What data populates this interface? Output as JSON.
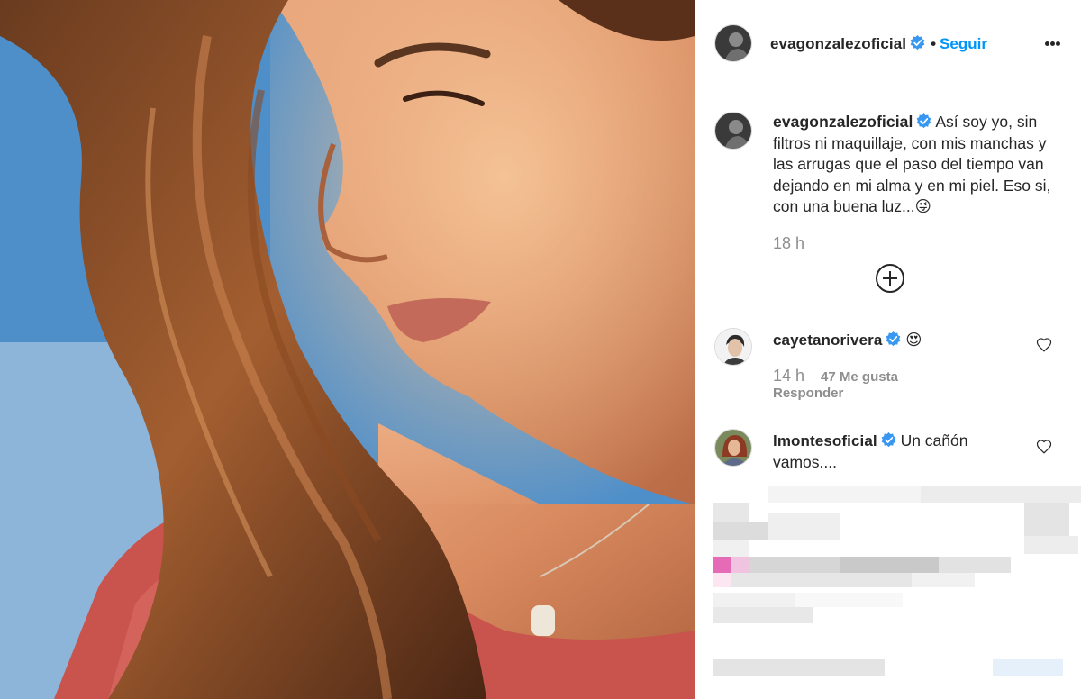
{
  "post": {
    "author": "evagonzalezoficial",
    "follow_label": "Seguir",
    "separator": "•",
    "caption_text": "Así soy yo, sin filtros ni maquillaje, con mis manchas y las arrugas que el paso del tiempo van dejando en mi alma y en mi piel. Eso si, con una buena luz...😜",
    "caption_time": "18 h"
  },
  "comments": [
    {
      "username": "cayetanorivera",
      "text": "😍",
      "time": "14 h",
      "likes": "47 Me gusta",
      "reply_label": "Responder"
    },
    {
      "username": "lmontesoficial",
      "text": "Un cañón vamos...."
    }
  ],
  "icons": {
    "verified": "verified-badge-icon",
    "more": "more-options-icon",
    "add": "plus-circle-icon",
    "like": "heart-icon"
  },
  "colors": {
    "link_blue": "#0095f6",
    "verified_blue": "#3897f0",
    "muted": "#8e8e8e",
    "text": "#262626"
  }
}
